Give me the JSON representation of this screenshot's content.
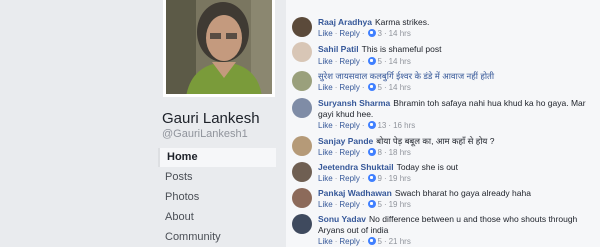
{
  "profile": {
    "name": "Gauri Lankesh",
    "handle": "@GauriLankesh1"
  },
  "nav": [
    {
      "label": "Home",
      "active": true
    },
    {
      "label": "Posts"
    },
    {
      "label": "Photos"
    },
    {
      "label": "About"
    },
    {
      "label": "Community"
    }
  ],
  "comment_actions": {
    "like": "Like",
    "reply": "Reply",
    "sep": "·"
  },
  "comments": [
    {
      "name": "Raaj Aradhya",
      "text": "Karma strikes.",
      "reactions": "3",
      "time": "14 hrs"
    },
    {
      "name": "Sahil Patil",
      "text": "This is shameful post",
      "reactions": "5",
      "time": "14 hrs"
    },
    {
      "name": "",
      "text": "सुरेश जायसवाल कलबुर्गि ईश्वर के डंडे में आवाज नहीं होती",
      "reactions": "5",
      "time": "14 hrs"
    },
    {
      "name": "Suryansh Sharma",
      "text": "Bhramin toh safaya nahi hua khud ka ho gaya. Mar gayi khud hee.",
      "reactions": "13",
      "time": "16 hrs"
    },
    {
      "name": "Sanjay Pande",
      "text": "बोया पेड़ बबूल का, आम कहाँ से होय ?",
      "reactions": "8",
      "time": "18 hrs"
    },
    {
      "name": "Jeetendra Shuktail",
      "text": "Today she is out",
      "reactions": "9",
      "time": "19 hrs"
    },
    {
      "name": "Pankaj Wadhawan",
      "text": "Swach bharat ho gaya already haha",
      "reactions": "5",
      "time": "19 hrs"
    },
    {
      "name": "Sonu Yadav",
      "text": "No difference between u and those who shouts through Aryans out of india",
      "reactions": "5",
      "time": "21 hrs"
    }
  ]
}
